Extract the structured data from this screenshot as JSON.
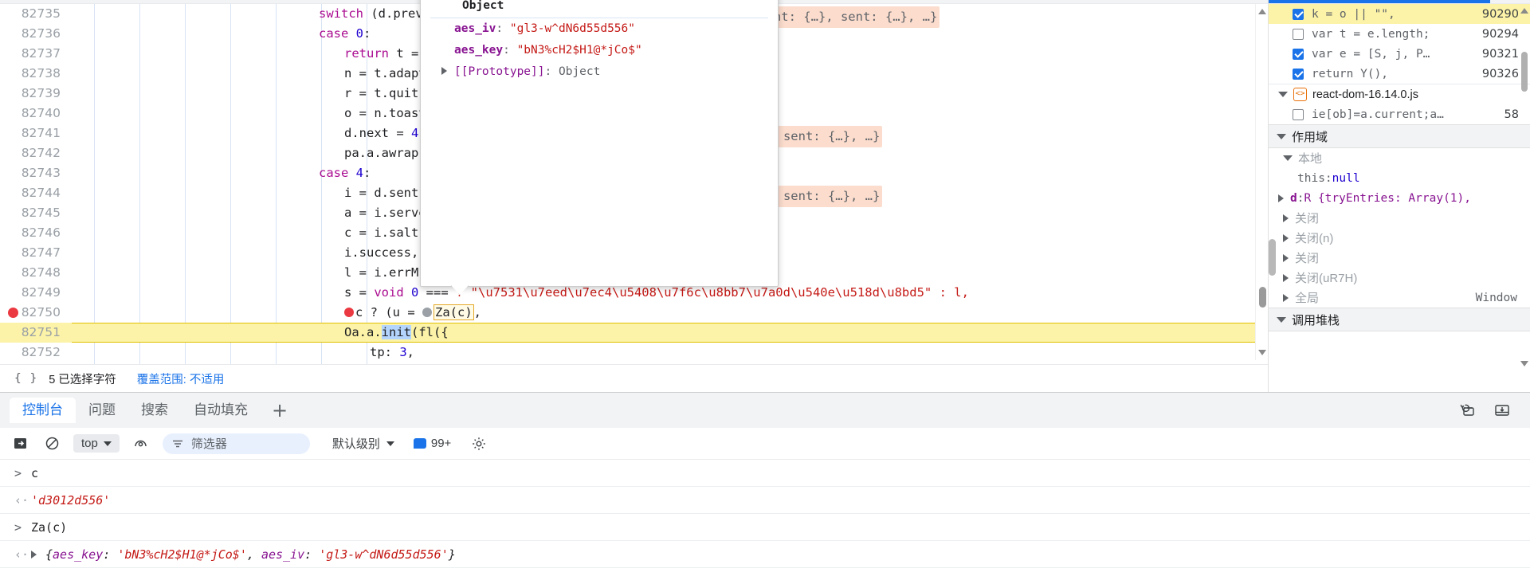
{
  "editor": {
    "lines": [
      {
        "no": "82735",
        "indent": 0,
        "breakpoint": false,
        "exec": false,
        "segments": [
          {
            "t": "switch ",
            "c": "kw"
          },
          {
            "t": "(d.prev",
            "c": "plain"
          }
        ],
        "inline_value": "v: 4, next: 4, _sent: {…}, sent: {…}, …}"
      },
      {
        "no": "82736",
        "indent": 0,
        "breakpoint": false,
        "exec": false,
        "segments": [
          {
            "t": "case ",
            "c": "kw"
          },
          {
            "t": "0",
            "c": "num"
          },
          {
            "t": ":",
            "c": "plain"
          }
        ],
        "inline_value": ""
      },
      {
        "no": "82737",
        "indent": 1,
        "breakpoint": false,
        "exec": false,
        "segments": [
          {
            "t": "return ",
            "c": "kw"
          },
          {
            "t": "t = ",
            "c": "plain"
          }
        ],
        "inline_value": ""
      },
      {
        "no": "82738",
        "indent": 1,
        "breakpoint": false,
        "exec": false,
        "segments": [
          {
            "t": "n = t.adapt",
            "c": "plain"
          }
        ],
        "inline_value": ""
      },
      {
        "no": "82739",
        "indent": 1,
        "breakpoint": false,
        "exec": false,
        "segments": [
          {
            "t": "r = t.quit,",
            "c": "plain"
          }
        ],
        "inline_value": ""
      },
      {
        "no": "82740",
        "indent": 1,
        "breakpoint": false,
        "exec": false,
        "segments": [
          {
            "t": "o = n.toast",
            "c": "plain"
          }
        ],
        "inline_value": ""
      },
      {
        "no": "82741",
        "indent": 1,
        "breakpoint": false,
        "exec": false,
        "segments": [
          {
            "t": "d.next = ",
            "c": "plain"
          },
          {
            "t": "4",
            "c": "num"
          },
          {
            "t": ",",
            "c": "plain"
          }
        ],
        "inline_value": "4, _sent: {…}, sent: {…}, …}"
      },
      {
        "no": "82742",
        "indent": 1,
        "breakpoint": false,
        "exec": false,
        "segments": [
          {
            "t": "pa.a.awrap(",
            "c": "plain"
          }
        ],
        "inline_value": ""
      },
      {
        "no": "82743",
        "indent": 0,
        "breakpoint": false,
        "exec": false,
        "segments": [
          {
            "t": "case ",
            "c": "kw"
          },
          {
            "t": "4",
            "c": "num"
          },
          {
            "t": ":",
            "c": "plain"
          }
        ],
        "inline_value": ""
      },
      {
        "no": "82744",
        "indent": 1,
        "breakpoint": false,
        "exec": false,
        "segments": [
          {
            "t": "i = d.sent,",
            "c": "plain"
          }
        ],
        "inline_value": "4, _sent: {…}, sent: {…}, …}"
      },
      {
        "no": "82745",
        "indent": 1,
        "breakpoint": false,
        "exec": false,
        "segments": [
          {
            "t": "a = i.serve",
            "c": "plain"
          }
        ],
        "inline_value": ""
      },
      {
        "no": "82746",
        "indent": 1,
        "breakpoint": false,
        "exec": false,
        "segments": [
          {
            "t": "c = i.salt,",
            "c": "plain"
          }
        ],
        "inline_value": ""
      },
      {
        "no": "82747",
        "indent": 1,
        "breakpoint": false,
        "exec": false,
        "segments": [
          {
            "t": "i.success,",
            "c": "plain"
          }
        ],
        "inline_value": ""
      },
      {
        "no": "82748",
        "indent": 1,
        "breakpoint": false,
        "exec": false,
        "segments": [
          {
            "t": "l = i.errMs",
            "c": "plain"
          }
        ],
        "inline_value": ""
      },
      {
        "no": "82749",
        "indent": 1,
        "breakpoint": false,
        "exec": false,
        "segments": [
          {
            "t": "s = ",
            "c": "plain"
          },
          {
            "t": "void ",
            "c": "kw"
          },
          {
            "t": "0",
            "c": "num"
          },
          {
            "t": " === ",
            "c": "plain"
          }
        ],
        "inline_value": ""
      },
      {
        "no": "82750",
        "indent": 1,
        "breakpoint": true,
        "exec": false,
        "segments": [],
        "inline_value": ""
      },
      {
        "no": "82751",
        "indent": 1,
        "breakpoint": false,
        "exec": true,
        "segments": [],
        "inline_value": ""
      },
      {
        "no": "82752",
        "indent": 2,
        "breakpoint": false,
        "exec": false,
        "segments": [
          {
            "t": "tp: ",
            "c": "plain"
          },
          {
            "t": "3",
            "c": "num"
          },
          {
            "t": ",",
            "c": "plain"
          }
        ],
        "inline_value": ""
      }
    ],
    "line_82749_tail": "? \"\\u7531\\u7eed\\u7ec4\\u5408\\u7f6c\\u8bb7\\u7a0d\\u540e\\u518d\\u8bd5\" : l,",
    "line_82750_code_pre": "c ? (u = ",
    "line_82750_token": "Za(c)",
    "line_82750_code_post": ",",
    "line_82751_pre": "Oa.a.",
    "line_82751_sel": "init",
    "line_82751_post": "(fl({"
  },
  "object_popup": {
    "title": "Object",
    "rows": [
      {
        "key": "aes_iv",
        "value": "\"gl3-w^dN6d55d556\"",
        "type": "string"
      },
      {
        "key": "aes_key",
        "value": "\"bN3%cH2$H1@*jCo$\"",
        "type": "string"
      }
    ],
    "prototype_key": "[[Prototype]]",
    "prototype_value": "Object"
  },
  "editor_status": {
    "braces_icon": "braces-icon",
    "selection_text": "5 已选择字符",
    "coverage_text": "覆盖范围: 不适用"
  },
  "debugger": {
    "breakpoints": [
      {
        "label": "k = o || \"\",",
        "line": "90290",
        "checked": true,
        "selected": true
      },
      {
        "label": "var t = e.length;",
        "line": "90294",
        "checked": false,
        "selected": false
      },
      {
        "label": "var e = [S, j, P…",
        "line": "90321",
        "checked": true,
        "selected": false
      },
      {
        "label": "return Y(),",
        "line": "90326",
        "checked": true,
        "selected": false
      }
    ],
    "file_group": {
      "name": "react-dom-16.14.0.js",
      "badge": "<>"
    },
    "file_breakpoints": [
      {
        "label": "ie[ob]=a.current;a…",
        "line": "58",
        "checked": false
      }
    ],
    "scope_header": "作用域",
    "scope_rows": [
      {
        "kind": "group",
        "caret": "down",
        "label": "本地"
      },
      {
        "kind": "prop",
        "name": "this",
        "value": "null",
        "value_type": "null"
      },
      {
        "kind": "prop-expand",
        "name": "d",
        "value": "R {tryEntries: Array(1),",
        "value_type": "object"
      },
      {
        "kind": "group-collapsed",
        "caret": "right",
        "label": "关闭"
      },
      {
        "kind": "group-collapsed",
        "caret": "right",
        "label": "关闭(n)"
      },
      {
        "kind": "group-collapsed",
        "caret": "right",
        "label": "关闭"
      },
      {
        "kind": "group-collapsed",
        "caret": "right",
        "label": "关闭(uR7H)"
      },
      {
        "kind": "group-collapsed",
        "caret": "right",
        "label": "全局",
        "right_value": "Window"
      }
    ],
    "callstack_header": "调用堆栈"
  },
  "drawer": {
    "tabs": [
      {
        "label": "控制台",
        "active": true
      },
      {
        "label": "问题",
        "active": false
      },
      {
        "label": "搜索",
        "active": false
      },
      {
        "label": "自动填充",
        "active": false
      }
    ],
    "add_tab_label": "+",
    "right_icons": [
      "restore-drawer-icon",
      "dock-bottom-icon"
    ]
  },
  "console_toolbar": {
    "exec_context_label": "top",
    "filter_placeholder": "筛选器",
    "level_label": "默认级别",
    "message_count": "99+",
    "icons": [
      "console-sidebar-icon",
      "clear-console-icon",
      "live-expression-icon",
      "filter-icon",
      "settings-gear-icon"
    ]
  },
  "console_entries": [
    {
      "type": "input",
      "marker": ">",
      "text": "c"
    },
    {
      "type": "output",
      "marker": "‹·",
      "text": "'d3012d556'",
      "style": "string"
    },
    {
      "type": "input",
      "marker": ">",
      "text": "Za(c)"
    },
    {
      "type": "output",
      "marker": "‹·",
      "expandable": true,
      "style": "object",
      "parts": [
        {
          "t": "{",
          "c": "plain"
        },
        {
          "t": "aes_key",
          "c": "key"
        },
        {
          "t": ": ",
          "c": "plain"
        },
        {
          "t": "'bN3%cH2$H1@*jCo$'",
          "c": "val"
        },
        {
          "t": ", ",
          "c": "plain"
        },
        {
          "t": "aes_iv",
          "c": "key"
        },
        {
          "t": ": ",
          "c": "plain"
        },
        {
          "t": "'gl3-w^dN6d55d556'",
          "c": "val"
        },
        {
          "t": "}",
          "c": "plain"
        }
      ]
    }
  ],
  "colors": {
    "accent": "#1a73e8",
    "breakpoint_red": "#eb3941",
    "exec_highlight": "#fcf3a8",
    "inline_value_bg": "#fbdccd",
    "string_red": "#c41a16",
    "property_purple": "#881391",
    "keyword_magenta": "#aa0d91",
    "number_blue": "#1c00cf",
    "js_badge_orange": "#e8710a"
  }
}
